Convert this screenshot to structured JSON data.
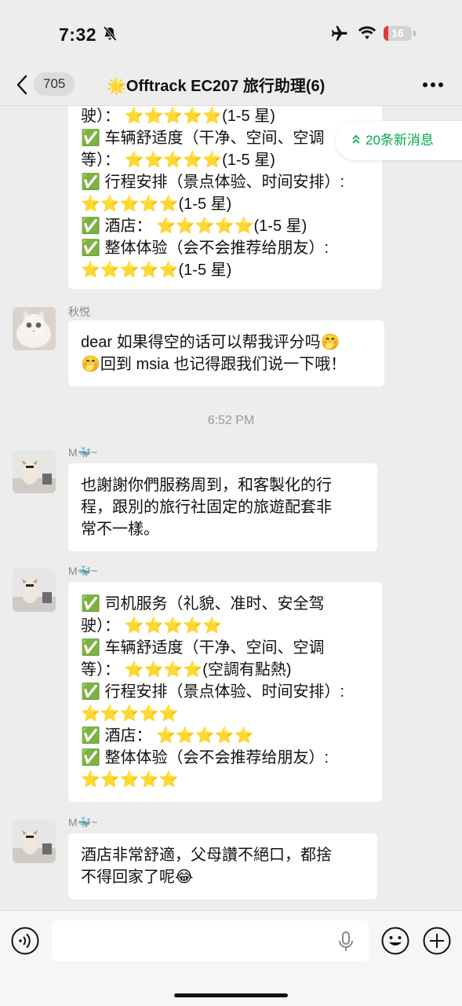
{
  "status_bar": {
    "time": "7:32",
    "battery": "16",
    "battery_level": 0.16
  },
  "nav": {
    "unread_count": "705",
    "title": "🌟Offtrack EC207 旅行助理(6)"
  },
  "new_messages": "20条新消息",
  "messages": [
    {
      "lines": [
        "驶）： ⭐⭐⭐⭐⭐(1-5 星)",
        "✅ 车辆舒适度（干净、空间、空调",
        "等）： ⭐⭐⭐⭐⭐(1-5 星)",
        "✅ 行程安排（景点体验、时间安排）:",
        "⭐⭐⭐⭐⭐(1-5 星)",
        "✅ 酒店： ⭐⭐⭐⭐⭐(1-5 星)",
        "✅ 整体体验（会不会推荐给朋友）:",
        "⭐⭐⭐⭐⭐(1-5 星)"
      ]
    },
    {
      "sender": "秋悦",
      "lines": [
        "dear 如果得空的话可以帮我评分吗🤭",
        "🤭回到 msia 也记得跟我们说一下哦！"
      ]
    },
    {
      "timestamp": "6:52 PM"
    },
    {
      "sender": "M🐳~",
      "lines": [
        "也謝謝你們服務周到，和客製化的行",
        "程，跟別的旅行社固定的旅遊配套非",
        "常不一樣。"
      ]
    },
    {
      "sender": "M🐳~",
      "lines": [
        "✅ 司机服务（礼貌、准时、安全驾",
        "驶）： ⭐⭐⭐⭐⭐",
        "✅ 车辆舒适度（干净、空间、空调",
        "等）： ⭐⭐⭐⭐(空調有點熱)",
        "✅ 行程安排（景点体验、时间安排）:",
        "⭐⭐⭐⭐⭐",
        "✅ 酒店： ⭐⭐⭐⭐⭐",
        "✅ 整体体验（会不会推荐给朋友）:",
        "⭐⭐⭐⭐⭐"
      ]
    },
    {
      "sender": "M🐳~",
      "lines": [
        "酒店非常舒適，父母讚不絕口，都捨",
        "不得回家了呢😂"
      ]
    }
  ],
  "icons": {
    "back": "chevron-left-icon",
    "more": "more-dots-icon",
    "voice": "voice-icon",
    "mic": "mic-icon",
    "emoji": "emoji-icon",
    "plus": "plus-icon",
    "mute": "bell-off-icon",
    "airplane": "airplane-icon",
    "wifi": "wifi-icon"
  },
  "colors": {
    "accent": "#07a84a",
    "background": "#ededed",
    "bubble": "#ffffff",
    "battery_low": "#e53935"
  }
}
